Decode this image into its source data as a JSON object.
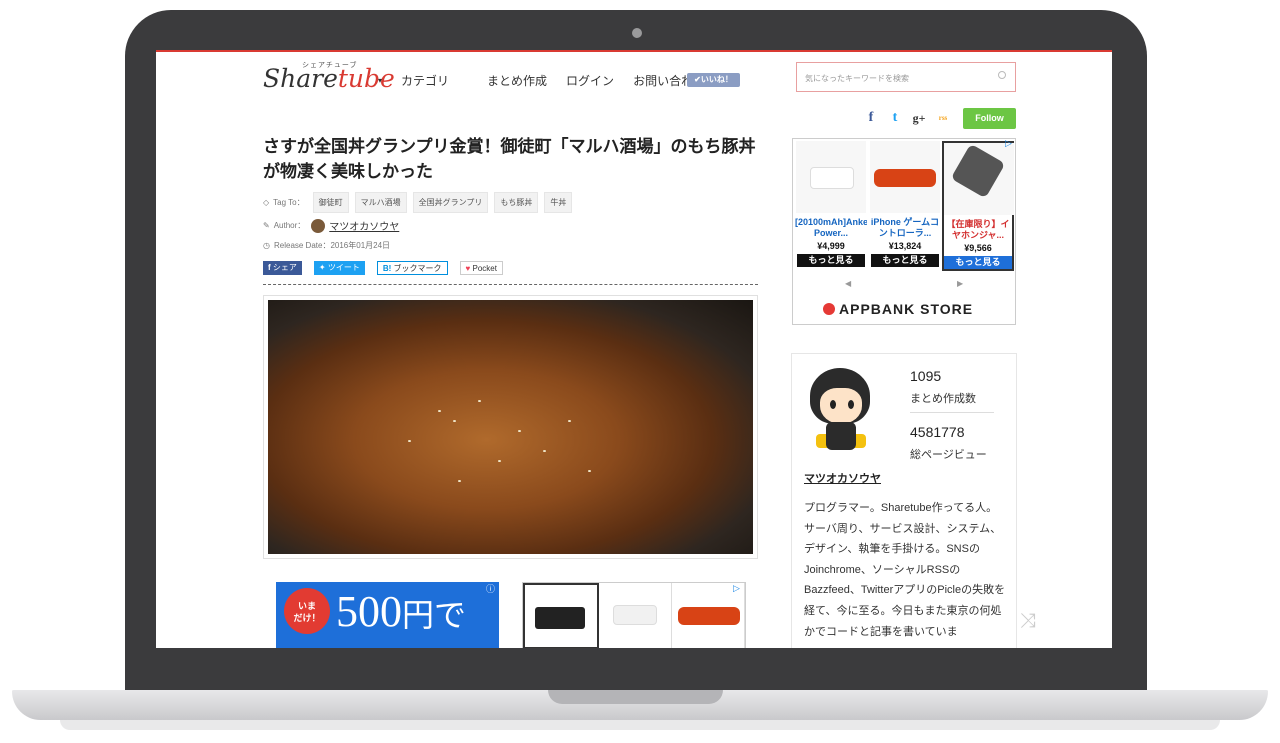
{
  "header": {
    "logo_text": "Share",
    "logo_text_accent": "tube",
    "logo_sub": "シェアチューブ",
    "nav": [
      "カテゴリ",
      "まとめ作成",
      "ログイン",
      "お問い合わせ"
    ],
    "iine": "✔いいね！",
    "search_placeholder": "気になったキーワードを検索",
    "social": {
      "fb": "f",
      "tw": "t",
      "gp": "g+",
      "rss": "rss"
    },
    "follow": "Follow"
  },
  "article": {
    "title": "さすが全国丼グランプリ金賞！御徒町「マルハ酒場」のもち豚丼が物凄く美味しかった",
    "tag_label": "Tag To：",
    "tags": [
      "御徒町",
      "マルハ酒場",
      "全国丼グランプリ",
      "もち豚丼",
      "牛丼"
    ],
    "author_label": "Author：",
    "author": "マツオカソウヤ",
    "release_label": "Release Date：2016年01月24日",
    "share": {
      "fb": "シェア",
      "tw": "ツイート",
      "hb": "ブックマーク",
      "pocket": "Pocket"
    }
  },
  "ads": {
    "banner_circle": "いま\nだけ！",
    "banner_text": "500",
    "banner_text_small": "円で",
    "store_name": "APPBANK STORE",
    "products": [
      {
        "name": "[20100mAh]Anker Power...",
        "price": "¥4,999",
        "more": "もっと見る"
      },
      {
        "name": "iPhone ゲームコントローラ...",
        "price": "¥13,824",
        "more": "もっと見る"
      },
      {
        "name": "【在庫限り】イヤホンジャ...",
        "price": "¥9,566",
        "more": "もっと見る"
      }
    ]
  },
  "profile": {
    "count_num": "1095",
    "count_label": "まとめ作成数",
    "views_num": "4581778",
    "views_label": "総ページビュー",
    "name": "マツオカソウヤ",
    "bio": "プログラマー。Sharetube作ってる人。サーバ周り、サービス設計、システム、デザイン、執筆を手掛ける。SNSのJoinchrome、ソーシャルRSSのBazzfeed、TwitterアプリのPicleの失敗を経て、今に至る。今日もまた東京の何処かでコードと記事を書いていま"
  }
}
